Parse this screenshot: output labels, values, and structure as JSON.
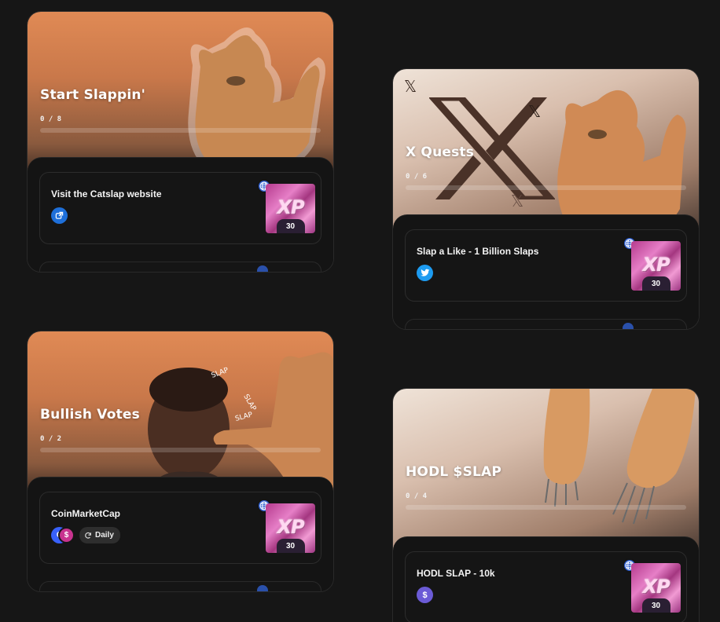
{
  "cards": [
    {
      "title": "Start Slappin'",
      "progress_label": "0 / 8",
      "progress_fraction": 0,
      "task": {
        "title": "Visit the Catslap website",
        "icon": "external-link-icon",
        "icon_color": "#1e6fd9",
        "xp_label": "XP",
        "xp_value": "30",
        "platform_icon": "globe-icon"
      }
    },
    {
      "title": "X Quests",
      "progress_label": "0 / 6",
      "progress_fraction": 0,
      "task": {
        "title": "Slap a Like - 1 Billion Slaps",
        "icon": "twitter-bird-icon",
        "icon_color": "#1d9bf0",
        "xp_label": "XP",
        "xp_value": "30",
        "platform_icon": "globe-icon"
      }
    },
    {
      "title": "Bullish Votes",
      "progress_label": "0 / 2",
      "progress_fraction": 0,
      "task": {
        "title": "CoinMarketCap",
        "icon": "coinmarketcap-icon",
        "icon_color": "#3861fb",
        "daily_label": "Daily",
        "xp_label": "XP",
        "xp_value": "30",
        "platform_icon": "globe-icon"
      }
    },
    {
      "title": "HODL $SLAP",
      "progress_label": "0 / 4",
      "progress_fraction": 0,
      "task": {
        "title": "HODL SLAP - 10k",
        "icon": "dollar-coin-icon",
        "icon_color": "#6b5bd6",
        "xp_label": "XP",
        "xp_value": "30",
        "platform_icon": "globe-icon"
      }
    }
  ],
  "colors": {
    "background": "#161616",
    "card_panel": "#141414",
    "accent_orange": "#e08a55",
    "xp_pink": "#e67fc7",
    "globe_blue": "#2f5fd0"
  }
}
